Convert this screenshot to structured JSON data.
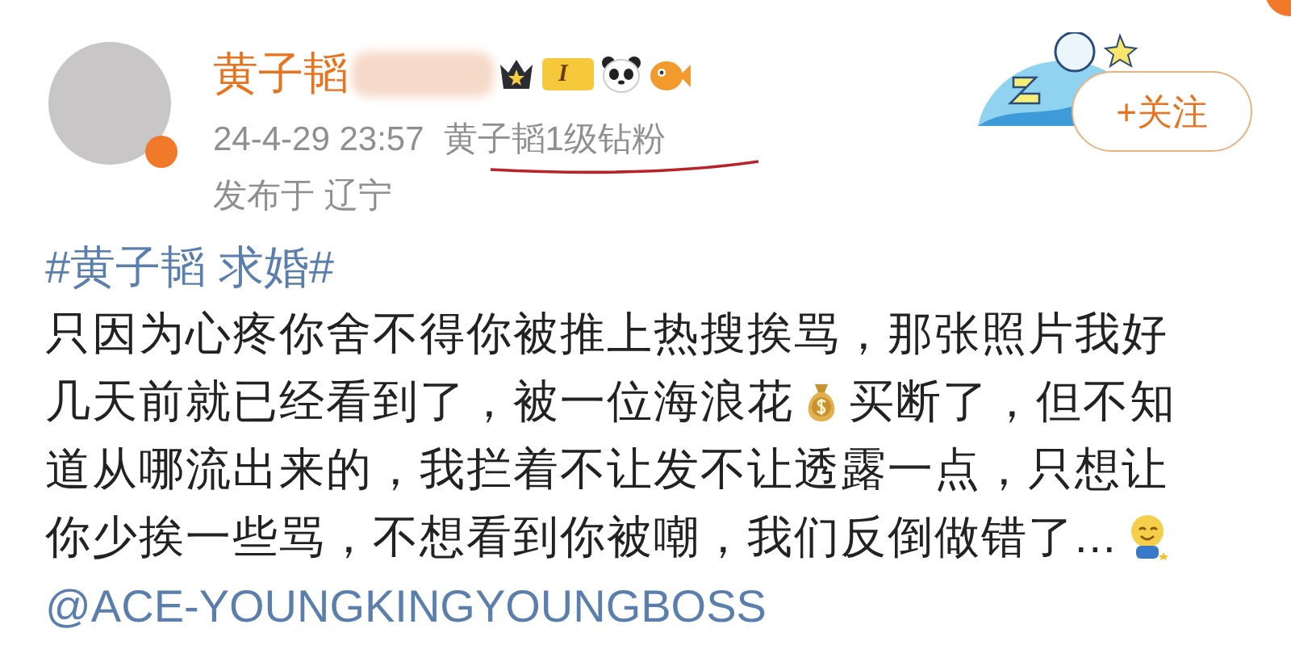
{
  "post": {
    "author": {
      "name": "黄子韬",
      "level_badge": "I"
    },
    "meta": {
      "time": "24-4-29 23:57",
      "fan_title": "黄子韬1级钻粉",
      "location": "发布于 辽宁"
    },
    "follow_button": "+关注",
    "hashtag": "#黄子韬 求婚#",
    "body_lines": [
      [
        {
          "kind": "text",
          "text": "只因为心疼你舍不得你被推上热搜挨骂，那张照片我好"
        }
      ],
      [
        {
          "kind": "text",
          "text": "几天前就已经看到了，被一位海浪花"
        },
        {
          "kind": "money"
        },
        {
          "kind": "text",
          "text": "买断了，但不知"
        }
      ],
      [
        {
          "kind": "text",
          "text": "道从哪流出来的，我拦着不让发不让透露一点，只想让"
        }
      ],
      [
        {
          "kind": "text",
          "text": "你少挨一些骂，不想看到你被嘲，我们反倒做错了..."
        },
        {
          "kind": "smile"
        }
      ]
    ],
    "mention": "@ACE-YOUNGKINGYOUNGBOSS"
  }
}
